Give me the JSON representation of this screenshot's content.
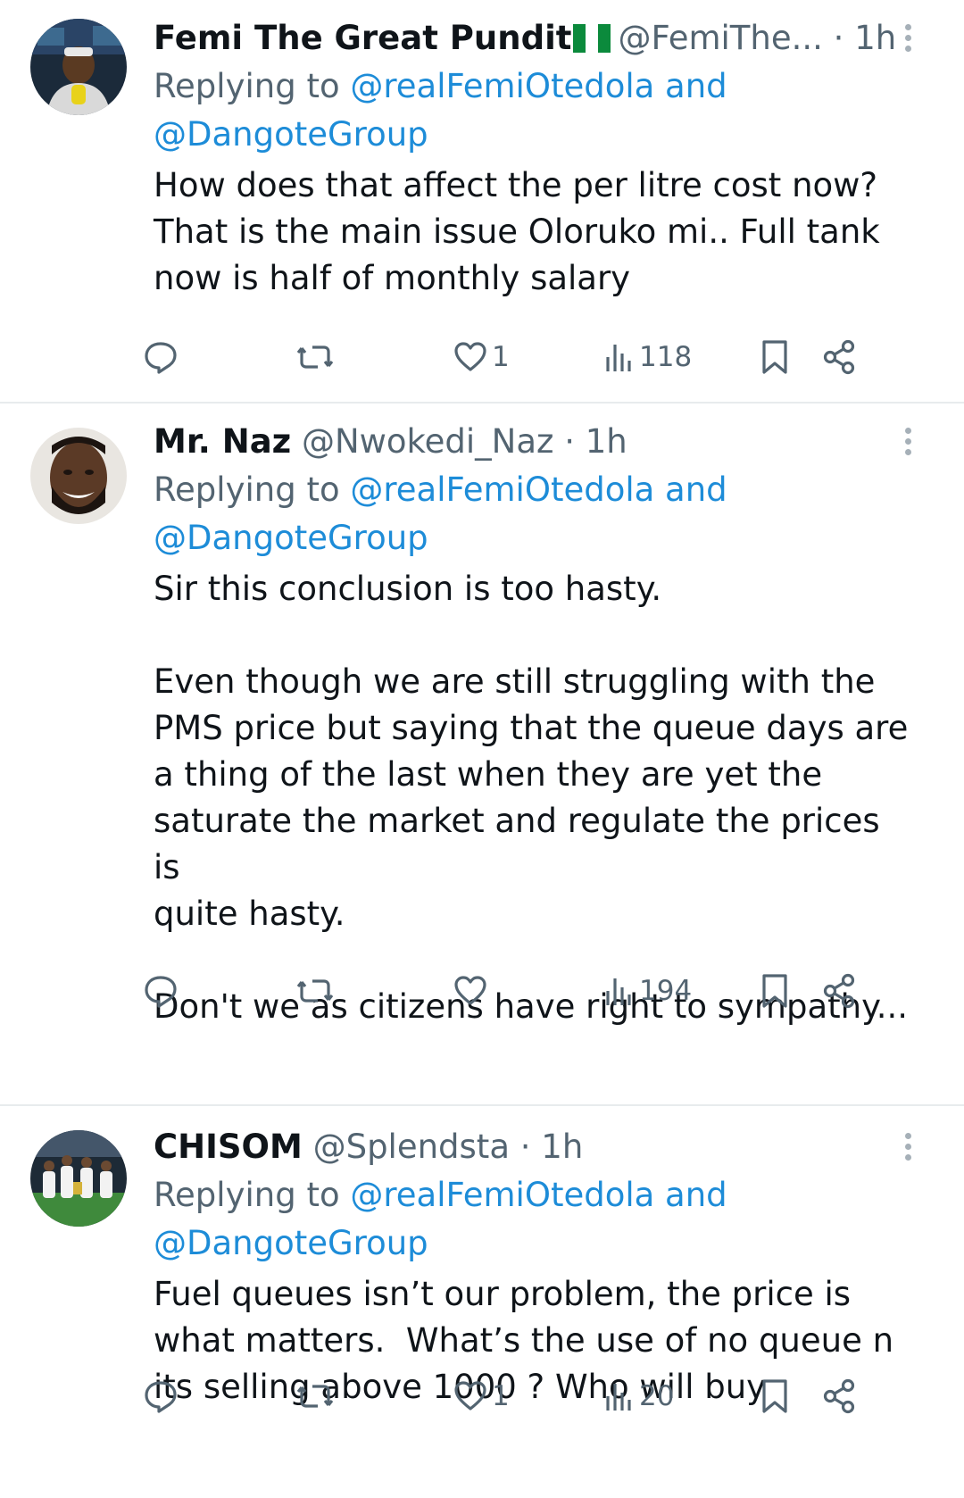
{
  "colors": {
    "link": "#1d8cd8",
    "muted": "#536471",
    "text": "#0f1419",
    "separator": "#e8ebed"
  },
  "tweets": [
    {
      "name": "Femi The Great Pundit",
      "flag": "nigeria-flag",
      "handle": "@FemiThe...",
      "time": "· 1h",
      "replying_prefix": "Replying to ",
      "replying_link1": "@realFemiOtedola and",
      "replying_link2": "@DangoteGroup",
      "text": "How does that affect the per litre cost now?\nThat is the main issue Oloruko mi.. Full tank\nnow is half of monthly salary",
      "likes": "1",
      "views": "118"
    },
    {
      "name": "Mr. Naz",
      "handle": "@Nwokedi_Naz",
      "time": "· 1h",
      "replying_prefix": "Replying to ",
      "replying_link1": "@realFemiOtedola and",
      "replying_link2": "@DangoteGroup",
      "text": "Sir this conclusion is too hasty.\n\nEven though we are still struggling with the\nPMS price but saying that the queue days are\na thing of the last when they are yet the\nsaturate the market and regulate the prices is\nquite hasty.\n\nDon't we as citizens have right to sympathy...",
      "likes": "",
      "views": "194"
    },
    {
      "name": "CHISOM",
      "handle": "@Splendsta",
      "time": "· 1h",
      "replying_prefix": "Replying to ",
      "replying_link1": "@realFemiOtedola and",
      "replying_link2": "@DangoteGroup",
      "text": "Fuel queues isn’t our problem, the price is\nwhat matters.  What’s the use of no queue n\nits selling above 1000 ? Who will buy",
      "likes": "1",
      "views": "20"
    }
  ]
}
